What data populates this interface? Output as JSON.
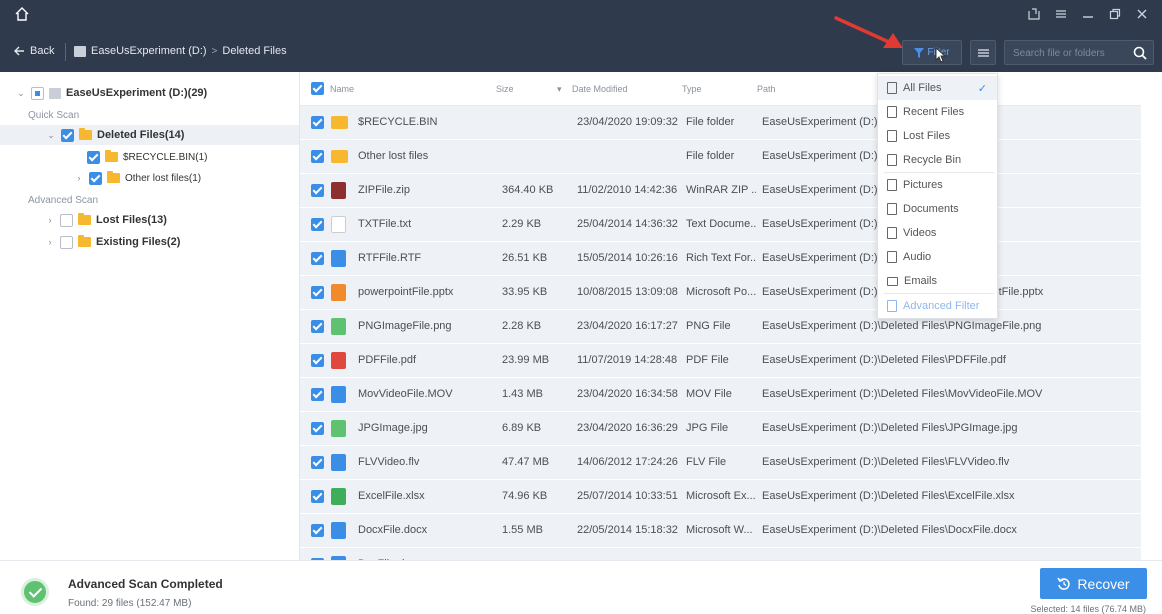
{
  "topbar": {
    "back_label": "Back",
    "drive_label": "EaseUsExperiment (D:)",
    "crumb_sep": ">",
    "folder_label": "Deleted Files",
    "filter_label": "Filter",
    "search_placeholder": "Search file or folders"
  },
  "sidebar": {
    "root_label": "EaseUsExperiment (D:)(29)",
    "quick_scan_label": "Quick Scan",
    "deleted_label": "Deleted Files(14)",
    "recycle_label": "$RECYCLE.BIN(1)",
    "other_lost_label": "Other lost files(1)",
    "advanced_scan_label": "Advanced Scan",
    "lost_files_label": "Lost Files(13)",
    "existing_files_label": "Existing Files(2)"
  },
  "columns": {
    "name": "Name",
    "size": "Size",
    "date": "Date Modified",
    "type": "Type",
    "path": "Path"
  },
  "files": [
    {
      "name": "$RECYCLE.BIN",
      "size": "",
      "date": "23/04/2020 19:09:32",
      "type": "File folder",
      "path": "EaseUsExperiment (D:)\\",
      "icon": "folder",
      "color": "#f5b82e"
    },
    {
      "name": "Other lost files",
      "size": "",
      "date": "",
      "type": "File folder",
      "path": "EaseUsExperiment (D:)\\",
      "icon": "folder",
      "color": "#f5b82e"
    },
    {
      "name": "ZIPFile.zip",
      "size": "364.40 KB",
      "date": "11/02/2010 14:42:36",
      "type": "WinRAR ZIP ...",
      "path": "EaseUsExperiment (D:)\\",
      "icon": "zip",
      "color": "#8e2f2f"
    },
    {
      "name": "TXTFile.txt",
      "size": "2.29 KB",
      "date": "25/04/2014 14:36:32",
      "type": "Text Docume...",
      "path": "EaseUsExperiment (D:)\\",
      "icon": "txt",
      "color": "#c9ced6"
    },
    {
      "name": "RTFFile.RTF",
      "size": "26.51 KB",
      "date": "15/05/2014 10:26:16",
      "type": "Rich Text For...",
      "path": "EaseUsExperiment (D:)\\",
      "icon": "doc",
      "color": "#3a8ee6"
    },
    {
      "name": "powerpointFile.pptx",
      "size": "33.95 KB",
      "date": "10/08/2015 13:09:08",
      "type": "Microsoft Po...",
      "path": "EaseUsExperiment (D:)\\Deleted Files\\powerpointFile.pptx",
      "icon": "ppt",
      "color": "#f08a2c"
    },
    {
      "name": "PNGImageFile.png",
      "size": "2.28 KB",
      "date": "23/04/2020 16:17:27",
      "type": "PNG File",
      "path": "EaseUsExperiment (D:)\\Deleted Files\\PNGImageFile.png",
      "icon": "img",
      "color": "#5fc270"
    },
    {
      "name": "PDFFile.pdf",
      "size": "23.99 MB",
      "date": "11/07/2019 14:28:48",
      "type": "PDF File",
      "path": "EaseUsExperiment (D:)\\Deleted Files\\PDFFile.pdf",
      "icon": "pdf",
      "color": "#e0483d"
    },
    {
      "name": "MovVideoFile.MOV",
      "size": "1.43 MB",
      "date": "23/04/2020 16:34:58",
      "type": "MOV File",
      "path": "EaseUsExperiment (D:)\\Deleted Files\\MovVideoFile.MOV",
      "icon": "video",
      "color": "#3a8ee6"
    },
    {
      "name": "JPGImage.jpg",
      "size": "6.89 KB",
      "date": "23/04/2020 16:36:29",
      "type": "JPG File",
      "path": "EaseUsExperiment (D:)\\Deleted Files\\JPGImage.jpg",
      "icon": "img",
      "color": "#5fc270"
    },
    {
      "name": "FLVVideo.flv",
      "size": "47.47 MB",
      "date": "14/06/2012 17:24:26",
      "type": "FLV File",
      "path": "EaseUsExperiment (D:)\\Deleted Files\\FLVVideo.flv",
      "icon": "video",
      "color": "#3a8ee6"
    },
    {
      "name": "ExcelFile.xlsx",
      "size": "74.96 KB",
      "date": "25/07/2014 10:33:51",
      "type": "Microsoft Ex...",
      "path": "EaseUsExperiment (D:)\\Deleted Files\\ExcelFile.xlsx",
      "icon": "xls",
      "color": "#3fae5a"
    },
    {
      "name": "DocxFile.docx",
      "size": "1.55 MB",
      "date": "22/05/2014 15:18:32",
      "type": "Microsoft W...",
      "path": "EaseUsExperiment (D:)\\Deleted Files\\DocxFile.docx",
      "icon": "doc",
      "color": "#3a8ee6"
    },
    {
      "name": "DocFile.doc",
      "size": "",
      "date": "",
      "type": "",
      "path": "",
      "icon": "doc",
      "color": "#3a8ee6"
    }
  ],
  "filter_menu": {
    "items": [
      "All Files",
      "Recent Files",
      "Lost Files",
      "Recycle Bin",
      "Pictures",
      "Documents",
      "Videos",
      "Audio",
      "Emails",
      "Advanced Filter"
    ],
    "checkmark": "✓"
  },
  "footer": {
    "status_title": "Advanced Scan Completed",
    "status_sub": "Found: 29 files (152.47 MB)",
    "recover_label": "Recover",
    "selected_info": "Selected: 14 files (76.74 MB)"
  },
  "colors": {
    "accent": "#3b8fe6",
    "topbar": "#2f3a4c",
    "success": "#5fc270",
    "arrow": "#e03a32"
  }
}
